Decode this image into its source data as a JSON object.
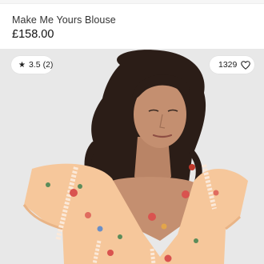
{
  "product": {
    "name": "Make Me Yours Blouse",
    "price": "£158.00"
  },
  "rating": {
    "value": "3.5",
    "count": "(2)",
    "icon": "star-icon"
  },
  "saves": {
    "count": "1329",
    "icon": "heart-icon"
  },
  "hero_image": {
    "subject": "model-wearing-peach-embroidered-blouse"
  },
  "colors": {
    "background": "#ffffff",
    "photo_backdrop": "#e9e9e9",
    "blouse": "#f6c79b",
    "text": "#222222"
  }
}
